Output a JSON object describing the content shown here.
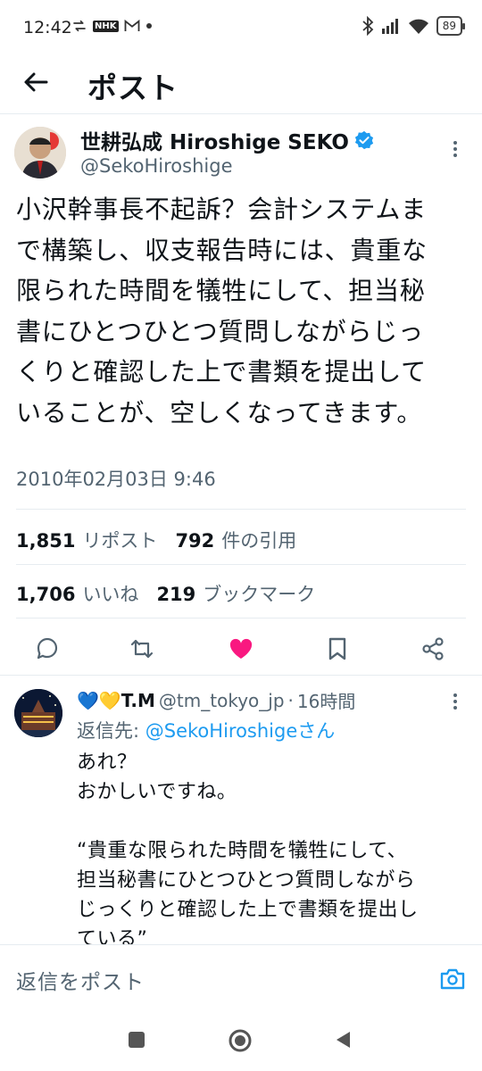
{
  "status_bar": {
    "time": "12:42",
    "battery": "89"
  },
  "header": {
    "title": "ポスト"
  },
  "post": {
    "author_name": "世耕弘成 Hiroshige SEKO",
    "author_handle": "@SekoHiroshige",
    "text": "小沢幹事長不起訴？会計システムま\nで構築し、収支報告時には、貴重な\n限られた時間を犠牲にして、担当秘\n書にひとつひとつ質問しながらじっ\nくりと確認した上で書類を提出して\nいることが、空しくなってきます。",
    "timestamp": "2010年02月03日 9:46",
    "reposts_count": "1,851",
    "reposts_label": "リポスト",
    "quotes_count": "792",
    "quotes_label": "件の引用",
    "likes_count": "1,706",
    "likes_label": "いいね",
    "bookmarks_count": "219",
    "bookmarks_label": "ブックマーク",
    "like_color": "#f91880"
  },
  "reply": {
    "display_name": "💙💛T.M",
    "handle": "@tm_tokyo_jp",
    "separator": "·",
    "time_ago": "16時間",
    "replying_prefix": "返信先: ",
    "replying_mention": "@SekoHiroshigeさん",
    "text": "あれ？\nおかしいですね。\n\n“貴重な限られた時間を犠牲にして、\n担当秘書にひとつひとつ質問しながら\nじっくりと確認した上で書類を提出し\nている”"
  },
  "compose": {
    "placeholder": "返信をポスト"
  },
  "colors": {
    "accent": "#1d9bf0",
    "secondary_text": "#536471",
    "like": "#f91880"
  }
}
